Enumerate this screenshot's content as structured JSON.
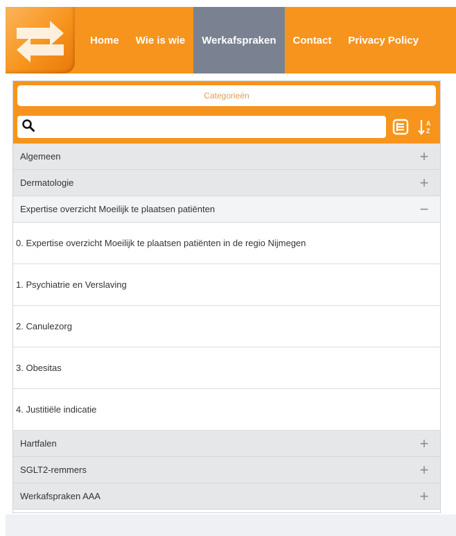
{
  "nav": {
    "items": [
      {
        "label": "Home",
        "active": false
      },
      {
        "label": "Wie is wie",
        "active": false
      },
      {
        "label": "Werkafspraken",
        "active": true
      },
      {
        "label": "Contact",
        "active": false
      },
      {
        "label": "Privacy Policy",
        "active": false
      }
    ]
  },
  "panel": {
    "categories_label": "Categorieën",
    "search": {
      "value": "",
      "placeholder": ""
    },
    "collapsed_top": [
      {
        "label": "Algemeen",
        "toggle": "+"
      },
      {
        "label": "Dermatologie",
        "toggle": "+"
      }
    ],
    "open_category": {
      "label": "Expertise overzicht Moeilijk te plaatsen patiënten",
      "toggle": "−"
    },
    "open_items": [
      "0. Expertise overzicht Moeilijk te plaatsen patiënten in de regio Nijmegen",
      "1. Psychiatrie en Verslaving",
      "2. Canulezorg",
      "3. Obesitas",
      "4. Justitiële indicatie"
    ],
    "collapsed_bottom": [
      {
        "label": "Hartfalen",
        "toggle": "+"
      },
      {
        "label": "SGLT2-remmers",
        "toggle": "+"
      },
      {
        "label": "Werkafspraken AAA",
        "toggle": "+"
      }
    ]
  },
  "colors": {
    "accent": "#f7941d",
    "nav_active": "#7a8291",
    "row_bg": "#e6e7e9"
  }
}
